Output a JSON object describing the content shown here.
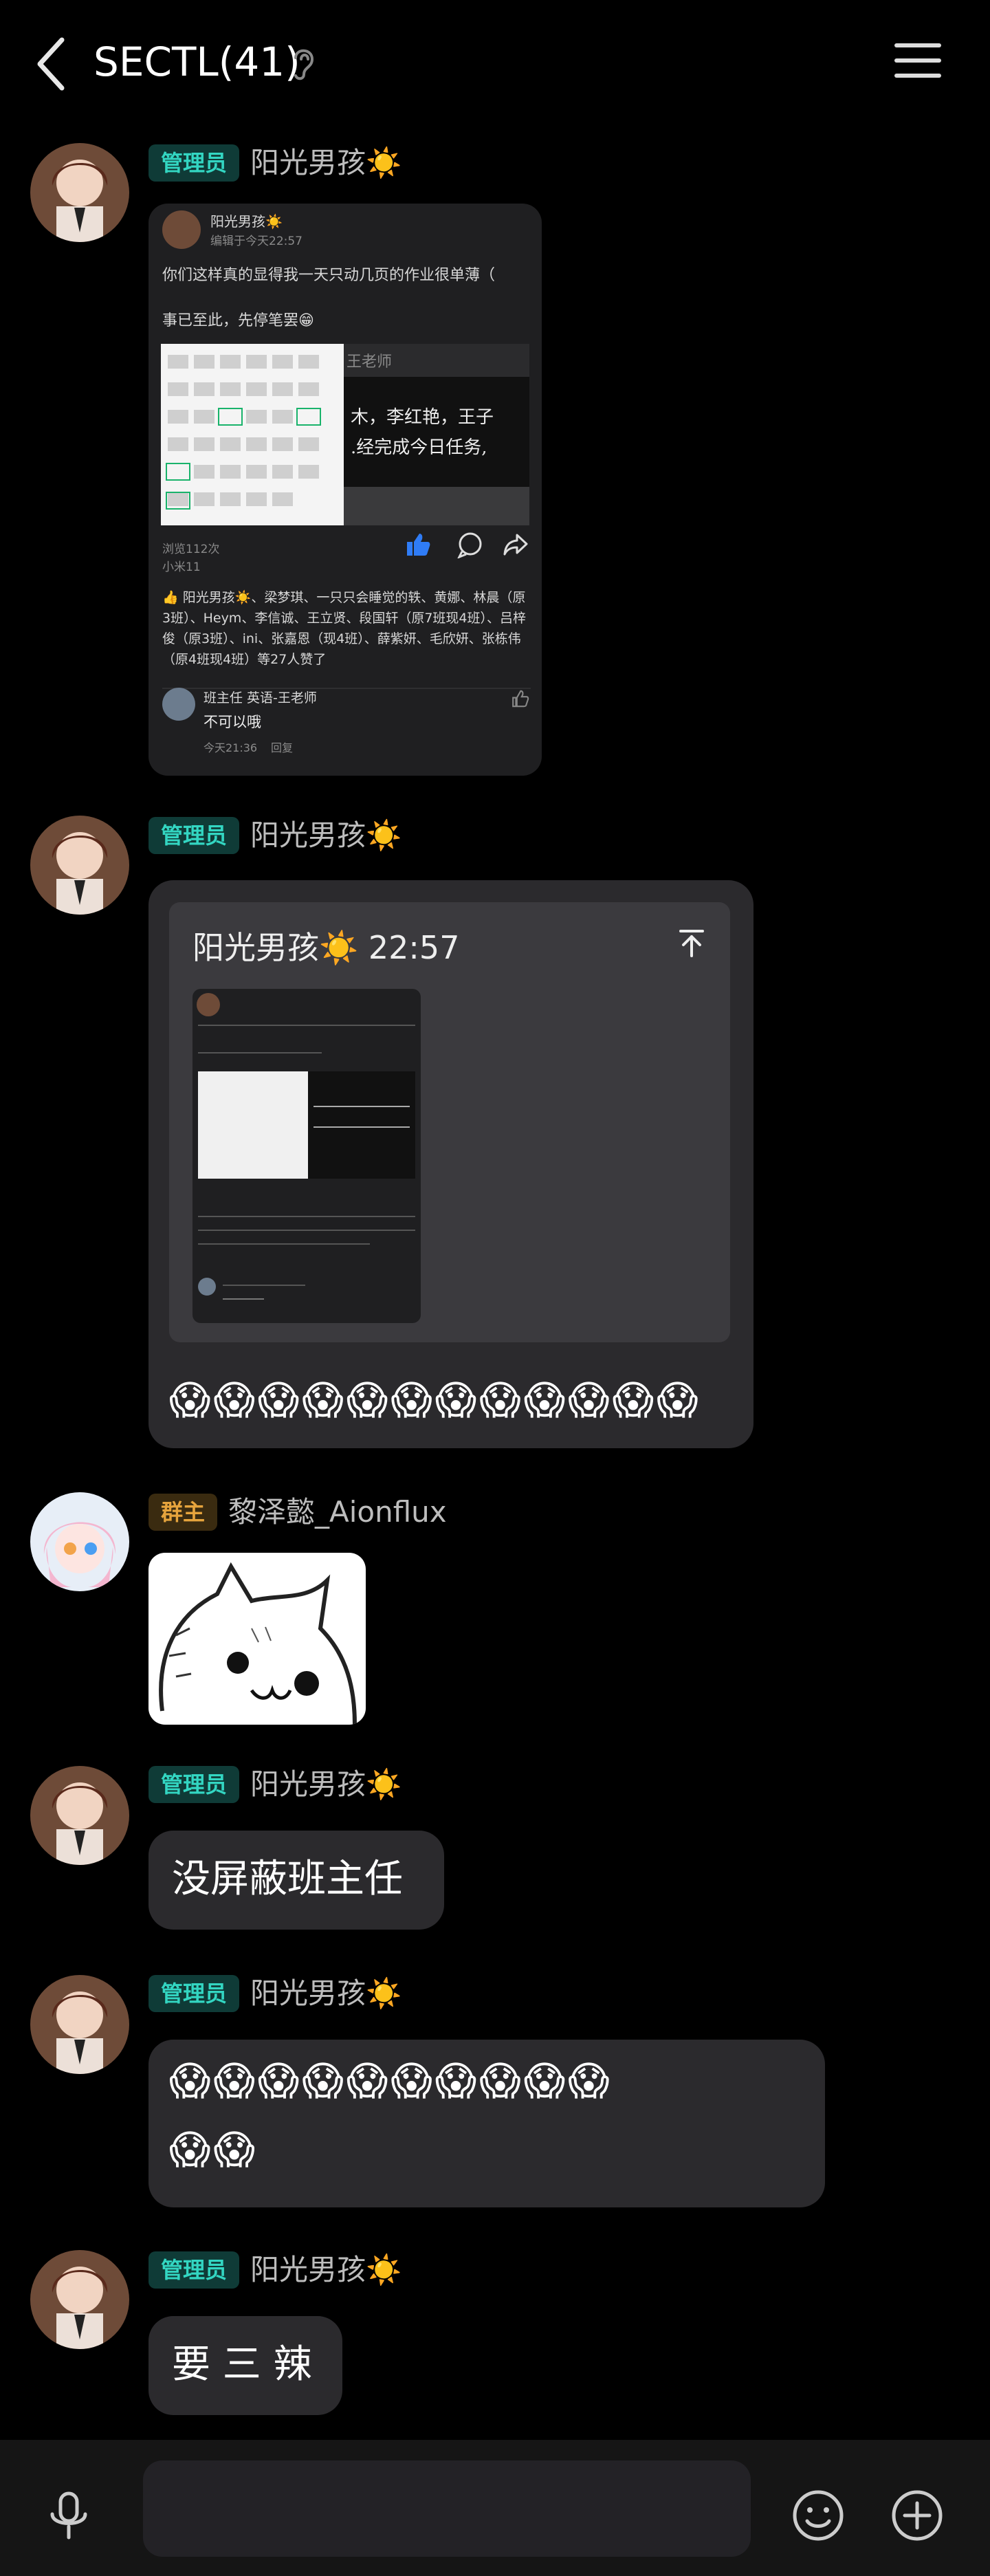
{
  "header": {
    "title": "SECTL(41)",
    "back_icon": "back-arrow-icon",
    "ear_icon": "ear-icon",
    "menu_icon": "menu-icon"
  },
  "colors": {
    "admin_badge_bg": "#0f3b37",
    "admin_badge_text": "#33d6c2",
    "owner_badge_bg": "#3a2b10",
    "owner_badge_text": "#e6a43d",
    "bubble": "#2b2a2d"
  },
  "messages": [
    {
      "badge": "管理员",
      "sender": "阳光男孩☀️",
      "type": "card",
      "card": {
        "author": "阳光男孩☀️",
        "edited": "编辑于今天22:57",
        "line1": "你们这样真的显得我一天只动几页的作业很单薄（",
        "line2": "事已至此，先停笔罢😁",
        "dark_text1": "王老师",
        "dark_text2": "木，李红艳，王子",
        "dark_text3": ".经完成今日任务,",
        "views": "浏览112次",
        "device": "小米11",
        "likes_text": "阳光男孩☀️、梁梦琪、一只只会睡觉的轶、黄娜、林晨（原3班）、Heym、李信诚、王立贤、段国轩（原7班现4班）、吕梓俊（原3班）、ini、张嘉恩（现4班）、薛紫妍、毛欣妍、张栋伟（原4班现4班）等27人赞了",
        "comment_name": "班主任 英语-王老师",
        "comment_text": "不可以哦",
        "comment_time": "今天21:36",
        "comment_reply": "回复"
      }
    },
    {
      "badge": "管理员",
      "sender": "阳光男孩☀️",
      "type": "quote",
      "quote_header": "阳光男孩☀️ 22:57",
      "emojis": "😱😱😱😱😱😱😱😱😱😱😱😱"
    },
    {
      "badge": "群主",
      "sender": "黎泽懿_Aionflux",
      "type": "sticker",
      "sticker_name": "cat-sticker"
    },
    {
      "badge": "管理员",
      "sender": "阳光男孩☀️",
      "type": "text",
      "text": "没屏蔽班主任"
    },
    {
      "badge": "管理员",
      "sender": "阳光男孩☀️",
      "type": "emoji",
      "line1": "😱😱😱😱😱😱😱😱😱😱",
      "line2": "😱😱"
    },
    {
      "badge": "管理员",
      "sender": "阳光男孩☀️",
      "type": "text",
      "text": "要 三 辣"
    }
  ],
  "input": {
    "placeholder": "",
    "voice_icon": "microphone-icon",
    "emoji_icon": "smiley-icon",
    "plus_icon": "plus-icon"
  }
}
